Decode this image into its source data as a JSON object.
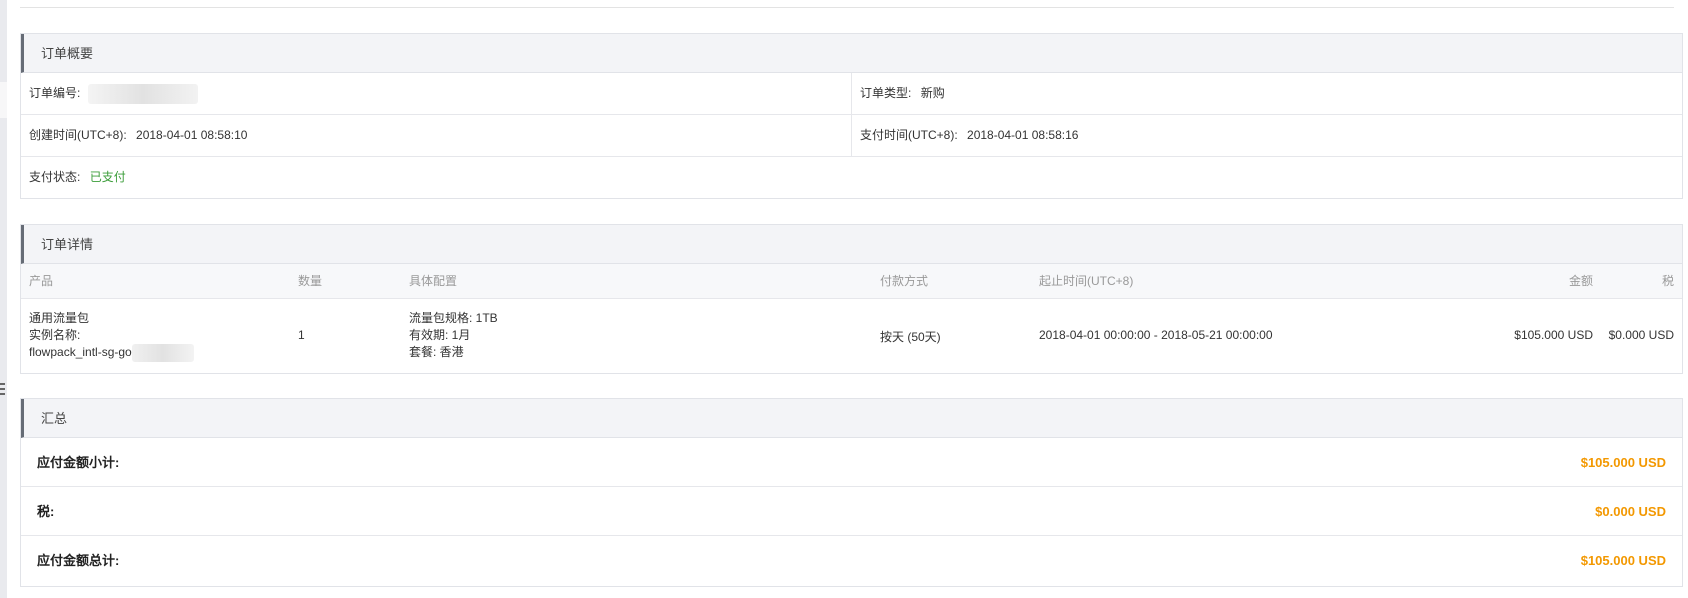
{
  "summary": {
    "title": "订单概要",
    "order_no_label": "订单编号:",
    "order_type_label": "订单类型:",
    "order_type_value": "新购",
    "created_label": "创建时间(UTC+8):",
    "created_value": "2018-04-01 08:58:10",
    "paid_time_label": "支付时间(UTC+8):",
    "paid_time_value": "2018-04-01 08:58:16",
    "status_label": "支付状态:",
    "status_value": "已支付"
  },
  "details": {
    "title": "订单详情",
    "columns": {
      "product": "产品",
      "quantity": "数量",
      "config": "具体配置",
      "payment": "付款方式",
      "period": "起止时间(UTC+8)",
      "amount": "金额",
      "tax": "税"
    },
    "row": {
      "product_name": "通用流量包",
      "instance_label": "实例名称:",
      "instance_name": "flowpack_intl-sg-go",
      "quantity": "1",
      "config_spec": "流量包规格: 1TB",
      "config_validity": "有效期: 1月",
      "config_plan": "套餐: 香港",
      "payment": "按天 (50天)",
      "period": "2018-04-01 00:00:00 - 2018-05-21 00:00:00",
      "amount": "$105.000 USD",
      "tax": "$0.000 USD"
    }
  },
  "totals": {
    "title": "汇总",
    "subtotal_label": "应付金额小计:",
    "subtotal_value": "$105.000 USD",
    "tax_label": "税:",
    "tax_value": "$0.000 USD",
    "total_label": "应付金额总计:",
    "total_value": "$105.000 USD"
  },
  "colors": {
    "paid_status": "#3a9c38",
    "amount_accent": "#f39800",
    "panel_header_bg": "#f3f4f7"
  }
}
